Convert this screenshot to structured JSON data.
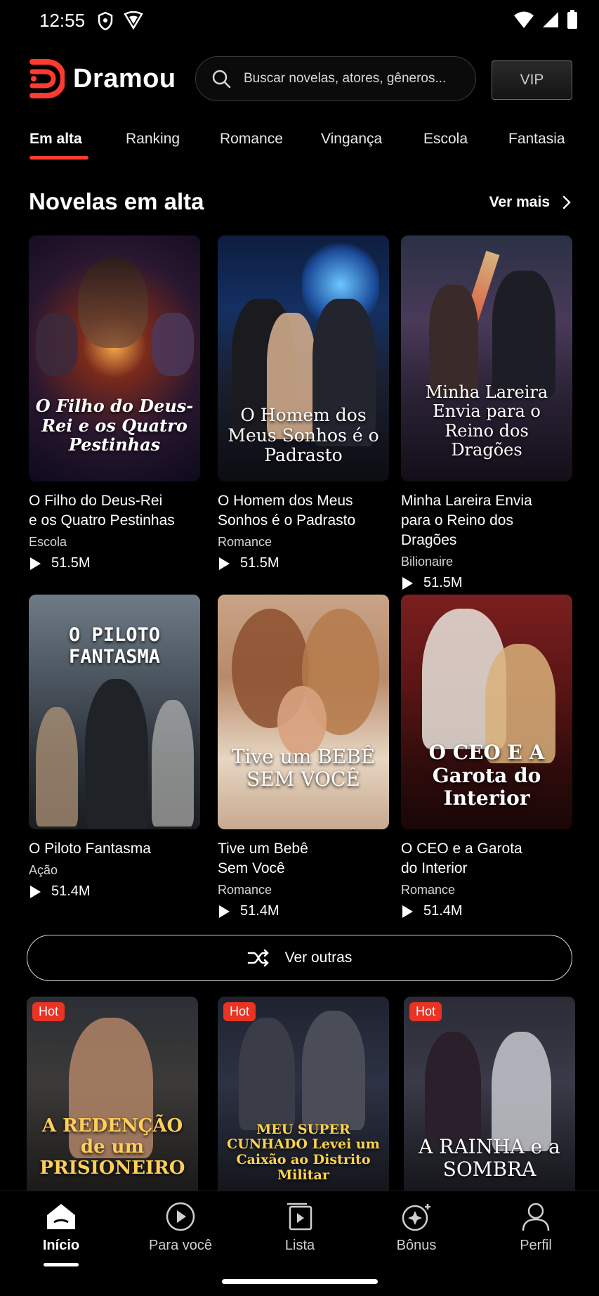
{
  "status_bar": {
    "time": "12:55"
  },
  "header": {
    "app_name": "Dramou",
    "search_placeholder": "Buscar novelas, atores, gêneros...",
    "vip_label": "VIP"
  },
  "tabs": [
    "Em alta",
    "Ranking",
    "Romance",
    "Vingança",
    "Escola",
    "Fantasia"
  ],
  "section": {
    "title": "Novelas em alta",
    "see_more": "Ver mais"
  },
  "dramas": [
    {
      "poster_title": "O Filho do Deus-Rei e os Quatro Pestinhas",
      "title_line1": "O Filho do Deus-Rei",
      "title_line2": "e os Quatro Pestinhas",
      "genre": "Escola",
      "views": "51.5M"
    },
    {
      "poster_title": "O Homem dos Meus Sonhos é o Padrasto",
      "title_line1": "O Homem dos Meus",
      "title_line2": "Sonhos é o Padrasto",
      "genre": "Romance",
      "views": "51.5M"
    },
    {
      "poster_title": "Minha Lareira Envia para o Reino dos Dragões",
      "title_line1": "Minha Lareira Envia",
      "title_line2": "para o Reino dos Dragões",
      "genre": "Bilionaire",
      "views": "51.5M"
    },
    {
      "poster_title": "O PILOTO FANTASMA",
      "title_line1": "O Piloto Fantasma",
      "title_line2": "",
      "genre": "Ação",
      "views": "51.4M"
    },
    {
      "poster_title": "Tive um BEBÊ SEM VOCÊ",
      "title_line1": "Tive um Bebê",
      "title_line2": "Sem Você",
      "genre": "Romance",
      "views": "51.4M"
    },
    {
      "poster_title": "O CEO E A Garota do Interior",
      "title_line1": "O CEO e a Garota",
      "title_line2": "do Interior",
      "genre": "Romance",
      "views": "51.4M"
    }
  ],
  "shuffle_label": "Ver outras",
  "hot_dramas": [
    {
      "badge": "Hot",
      "poster_title": "A REDENÇÃO de um PRISIONEIRO"
    },
    {
      "badge": "Hot",
      "poster_title": "MEU SUPER CUNHADO Levei um Caixão ao Distrito Militar"
    },
    {
      "badge": "Hot",
      "poster_title": "A RAINHA e a SOMBRA"
    }
  ],
  "nav": [
    "Início",
    "Para você",
    "Lista",
    "Bônus",
    "Perfil"
  ],
  "colors": {
    "accent": "#ff3b2f",
    "background": "#000000",
    "hot": "#ea3323"
  }
}
